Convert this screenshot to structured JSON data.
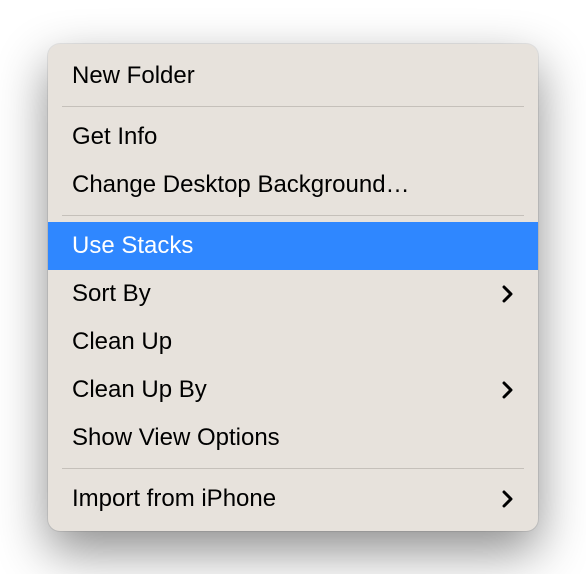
{
  "menu": {
    "items": [
      {
        "label": "New Folder",
        "submenu": false
      },
      {
        "label": "Get Info",
        "submenu": false
      },
      {
        "label": "Change Desktop Background…",
        "submenu": false
      },
      {
        "label": "Use Stacks",
        "submenu": false,
        "highlighted": true
      },
      {
        "label": "Sort By",
        "submenu": true
      },
      {
        "label": "Clean Up",
        "submenu": false
      },
      {
        "label": "Clean Up By",
        "submenu": true
      },
      {
        "label": "Show View Options",
        "submenu": false
      },
      {
        "label": "Import from iPhone",
        "submenu": true
      }
    ]
  }
}
